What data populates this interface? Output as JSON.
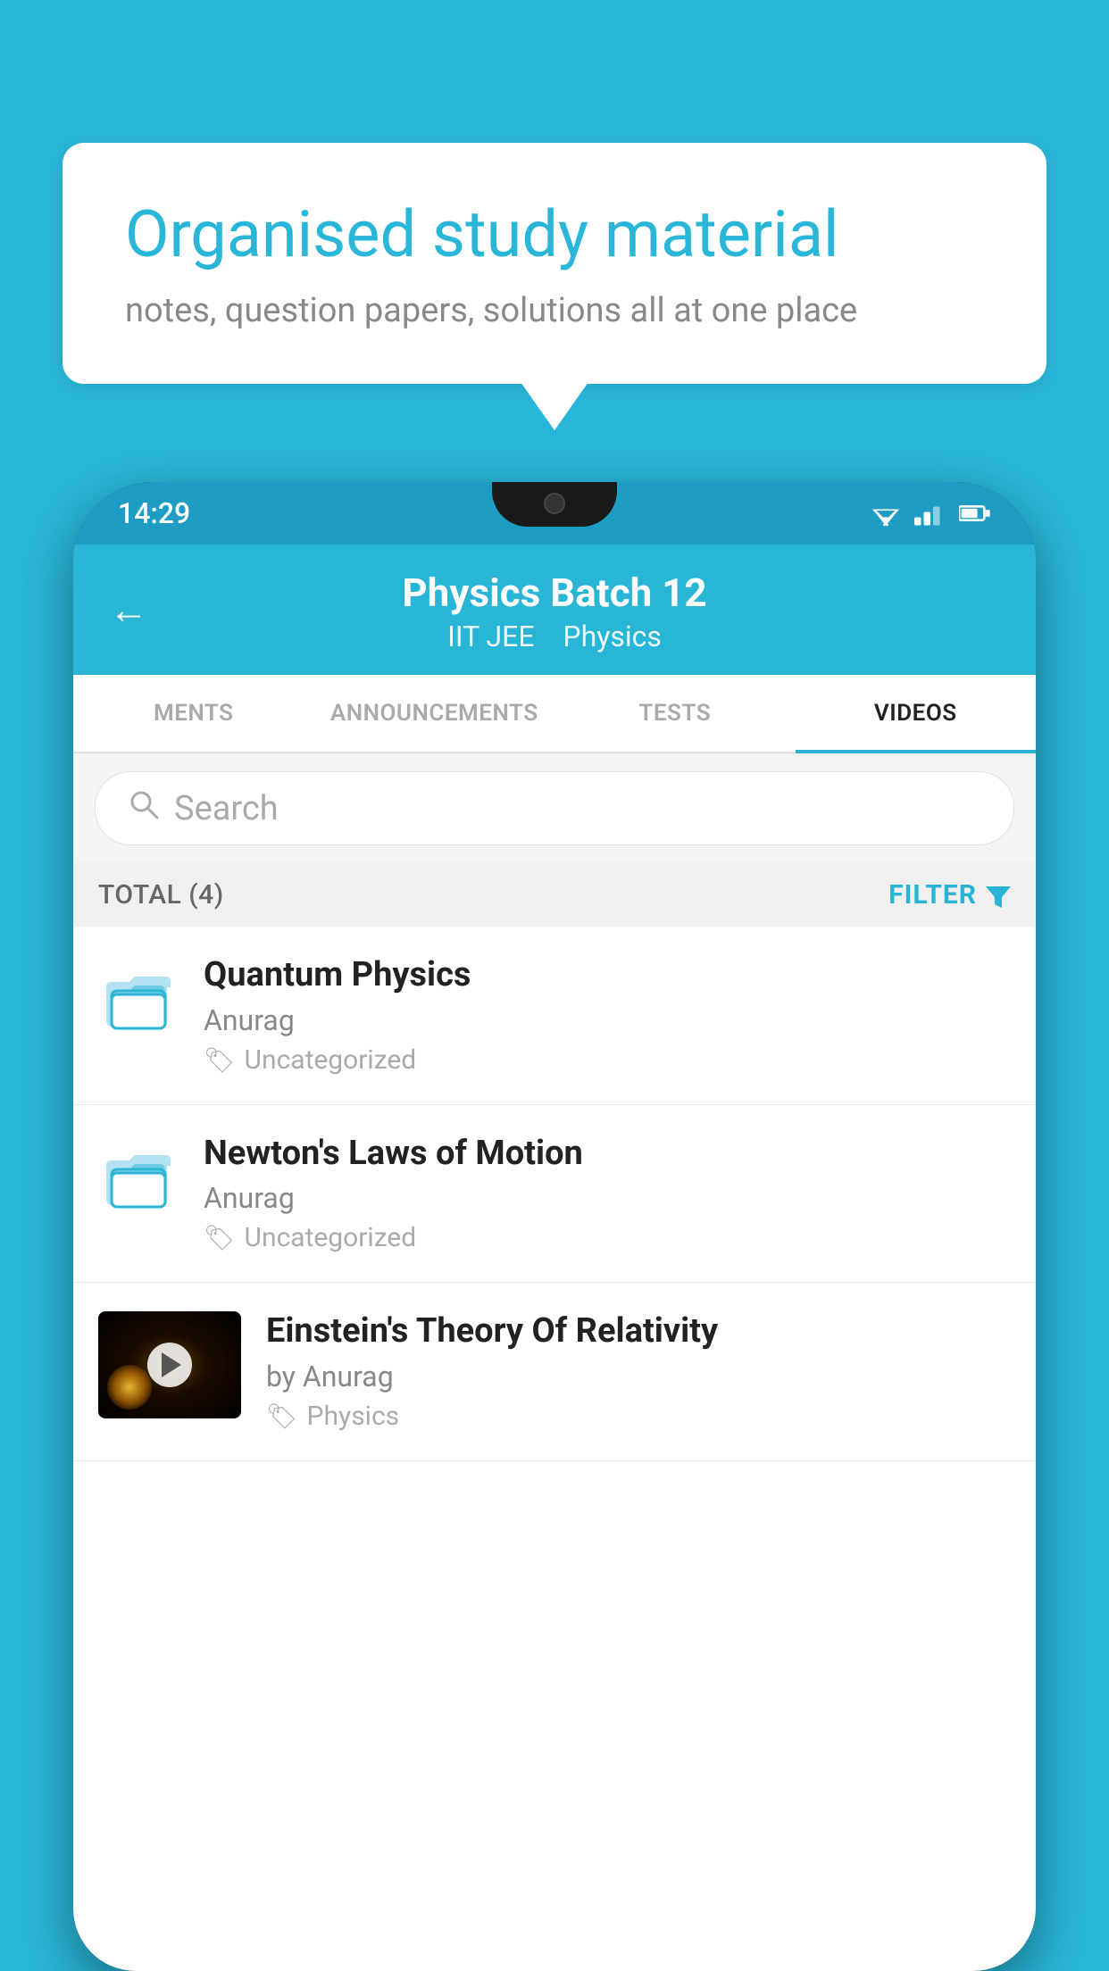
{
  "background_color": "#29b6d8",
  "speech_bubble": {
    "title": "Organised study material",
    "subtitle": "notes, question papers, solutions all at one place"
  },
  "status_bar": {
    "time": "14:29"
  },
  "header": {
    "title": "Physics Batch 12",
    "subtitle_part1": "IIT JEE",
    "subtitle_part2": "Physics",
    "back_label": "←"
  },
  "tabs": [
    {
      "label": "MENTS",
      "active": false
    },
    {
      "label": "ANNOUNCEMENTS",
      "active": false
    },
    {
      "label": "TESTS",
      "active": false
    },
    {
      "label": "VIDEOS",
      "active": true
    }
  ],
  "search": {
    "placeholder": "Search"
  },
  "filter_row": {
    "total": "TOTAL (4)",
    "filter_label": "FILTER"
  },
  "videos": [
    {
      "title": "Quantum Physics",
      "author": "Anurag",
      "tag": "Uncategorized",
      "has_thumbnail": false
    },
    {
      "title": "Newton's Laws of Motion",
      "author": "Anurag",
      "tag": "Uncategorized",
      "has_thumbnail": false
    },
    {
      "title": "Einstein's Theory Of Relativity",
      "author": "by Anurag",
      "tag": "Physics",
      "has_thumbnail": true
    }
  ]
}
